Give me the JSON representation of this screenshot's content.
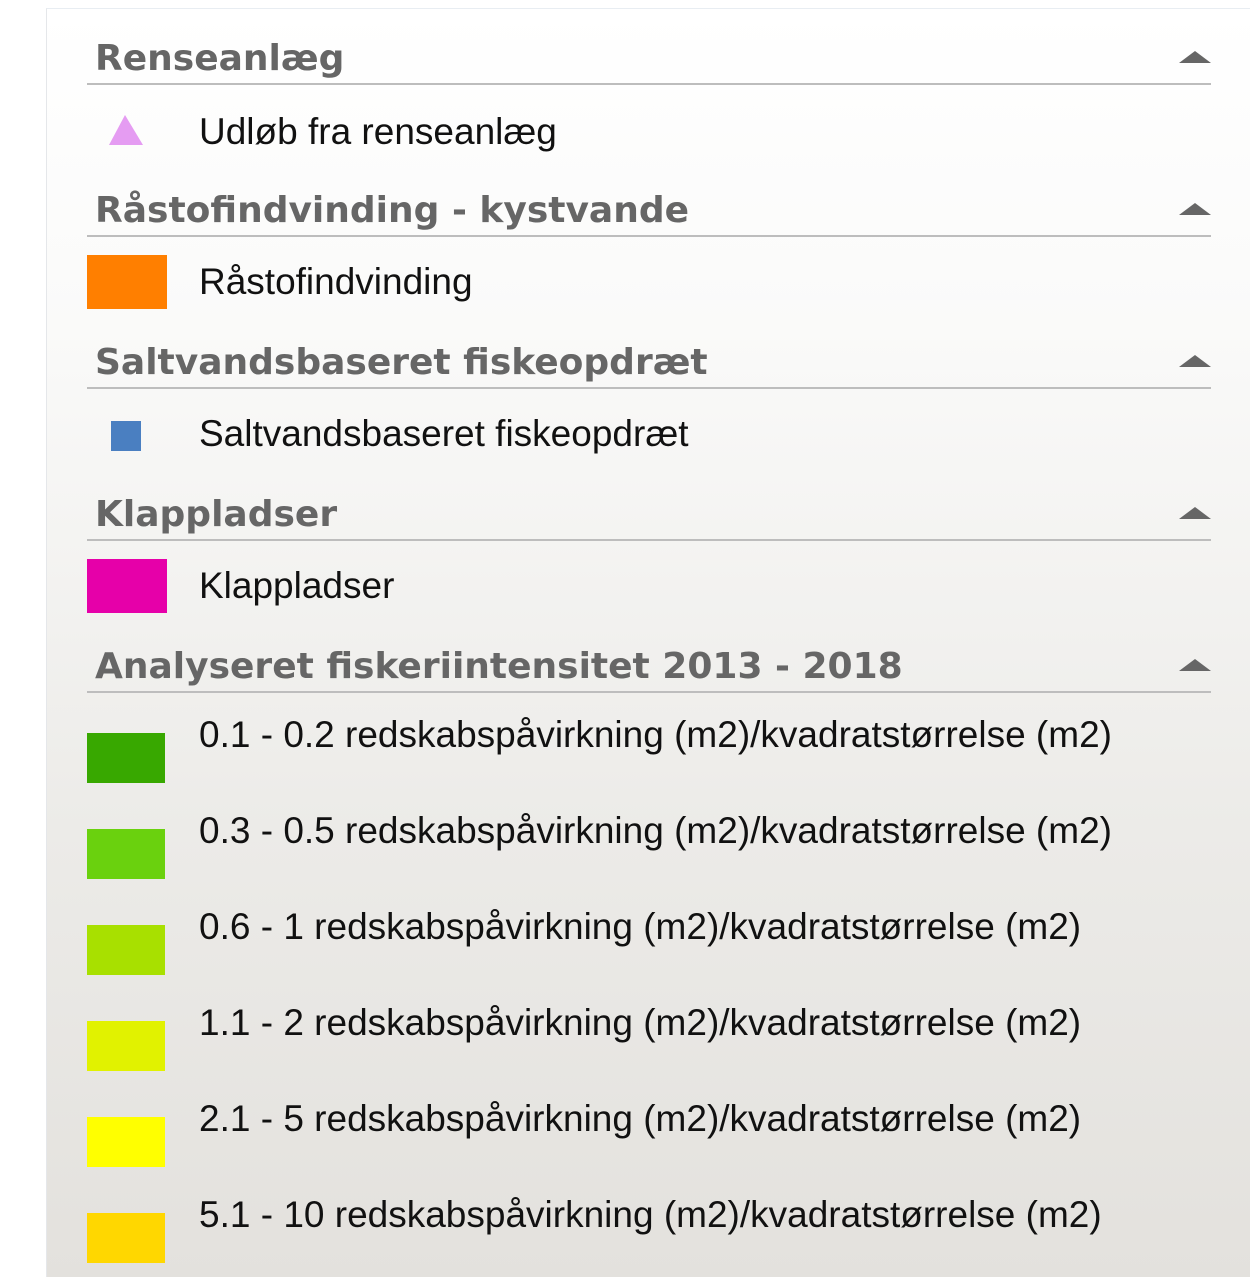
{
  "groups": [
    {
      "title": "Renseanlæg",
      "items": [
        {
          "label": "Udløb fra renseanlæg",
          "symbol": "triangle-icon",
          "color": "#e59cf2"
        }
      ]
    },
    {
      "title": "Råstofindvinding - kystvande",
      "items": [
        {
          "label": "Råstofindvinding",
          "symbol": "square",
          "color": "#ff7f00"
        }
      ]
    },
    {
      "title": "Saltvandsbaseret fiskeopdræt",
      "items": [
        {
          "label": "Saltvandsbaseret fiskeopdræt",
          "symbol": "small-square",
          "color": "#4a7fc1"
        }
      ]
    },
    {
      "title": "Klappladser",
      "items": [
        {
          "label": "Klappladser",
          "symbol": "square",
          "color": "#e600a9"
        }
      ]
    },
    {
      "title": "Analyseret fiskeriintensitet 2013 - 2018",
      "items": [
        {
          "label": "0.1 - 0.2 redskabspåvirkning (m2)/kvadratstørrelse (m2)",
          "color": "#38a800"
        },
        {
          "label": "0.3 - 0.5 redskabspåvirkning (m2)/kvadratstørrelse (m2)",
          "color": "#6ad10e"
        },
        {
          "label": "0.6 - 1 redskabspåvirkning (m2)/kvadratstørrelse (m2)",
          "color": "#a8e000"
        },
        {
          "label": "1.1 - 2 redskabspåvirkning (m2)/kvadratstørrelse (m2)",
          "color": "#e1f200"
        },
        {
          "label": "2.1 - 5 redskabspåvirkning (m2)/kvadratstørrelse (m2)",
          "color": "#ffff00"
        },
        {
          "label": "5.1 - 10 redskabspåvirkning (m2)/kvadratstørrelse (m2)",
          "color": "#ffd700"
        }
      ]
    }
  ],
  "icons": {
    "collapse": "chevron-up-icon"
  }
}
